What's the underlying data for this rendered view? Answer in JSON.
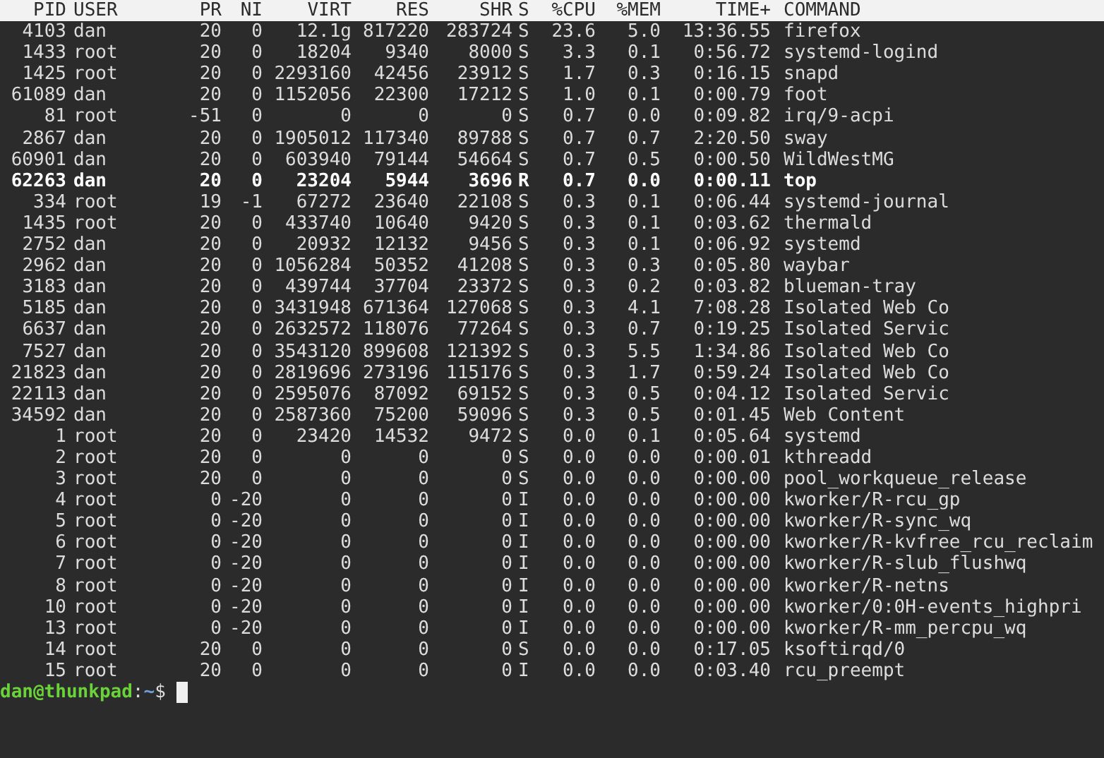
{
  "table": {
    "columns": [
      "PID",
      "USER",
      "PR",
      "NI",
      "VIRT",
      "RES",
      "SHR",
      "S",
      "%CPU",
      "%MEM",
      "TIME+",
      "COMMAND"
    ],
    "rows": [
      {
        "highlighted": false,
        "cells": [
          "4103",
          "dan",
          "20",
          "0",
          "12.1g",
          "817220",
          "283724",
          "S",
          "23.6",
          "5.0",
          "13:36.55",
          "firefox"
        ]
      },
      {
        "highlighted": false,
        "cells": [
          "1433",
          "root",
          "20",
          "0",
          "18204",
          "9340",
          "8000",
          "S",
          "3.3",
          "0.1",
          "0:56.72",
          "systemd-logind"
        ]
      },
      {
        "highlighted": false,
        "cells": [
          "1425",
          "root",
          "20",
          "0",
          "2293160",
          "42456",
          "23912",
          "S",
          "1.7",
          "0.3",
          "0:16.15",
          "snapd"
        ]
      },
      {
        "highlighted": false,
        "cells": [
          "61089",
          "dan",
          "20",
          "0",
          "1152056",
          "22300",
          "17212",
          "S",
          "1.0",
          "0.1",
          "0:00.79",
          "foot"
        ]
      },
      {
        "highlighted": false,
        "cells": [
          "81",
          "root",
          "-51",
          "0",
          "0",
          "0",
          "0",
          "S",
          "0.7",
          "0.0",
          "0:09.82",
          "irq/9-acpi"
        ]
      },
      {
        "highlighted": false,
        "cells": [
          "2867",
          "dan",
          "20",
          "0",
          "1905012",
          "117340",
          "89788",
          "S",
          "0.7",
          "0.7",
          "2:20.50",
          "sway"
        ]
      },
      {
        "highlighted": false,
        "cells": [
          "60901",
          "dan",
          "20",
          "0",
          "603940",
          "79144",
          "54664",
          "S",
          "0.7",
          "0.5",
          "0:00.50",
          "WildWestMG"
        ]
      },
      {
        "highlighted": true,
        "cells": [
          "62263",
          "dan",
          "20",
          "0",
          "23204",
          "5944",
          "3696",
          "R",
          "0.7",
          "0.0",
          "0:00.11",
          "top"
        ]
      },
      {
        "highlighted": false,
        "cells": [
          "334",
          "root",
          "19",
          "-1",
          "67272",
          "23640",
          "22108",
          "S",
          "0.3",
          "0.1",
          "0:06.44",
          "systemd-journal"
        ]
      },
      {
        "highlighted": false,
        "cells": [
          "1435",
          "root",
          "20",
          "0",
          "433740",
          "10640",
          "9420",
          "S",
          "0.3",
          "0.1",
          "0:03.62",
          "thermald"
        ]
      },
      {
        "highlighted": false,
        "cells": [
          "2752",
          "dan",
          "20",
          "0",
          "20932",
          "12132",
          "9456",
          "S",
          "0.3",
          "0.1",
          "0:06.92",
          "systemd"
        ]
      },
      {
        "highlighted": false,
        "cells": [
          "2962",
          "dan",
          "20",
          "0",
          "1056284",
          "50352",
          "41208",
          "S",
          "0.3",
          "0.3",
          "0:05.80",
          "waybar"
        ]
      },
      {
        "highlighted": false,
        "cells": [
          "3183",
          "dan",
          "20",
          "0",
          "439744",
          "37704",
          "23372",
          "S",
          "0.3",
          "0.2",
          "0:03.82",
          "blueman-tray"
        ]
      },
      {
        "highlighted": false,
        "cells": [
          "5185",
          "dan",
          "20",
          "0",
          "3431948",
          "671364",
          "127068",
          "S",
          "0.3",
          "4.1",
          "7:08.28",
          "Isolated Web Co"
        ]
      },
      {
        "highlighted": false,
        "cells": [
          "6637",
          "dan",
          "20",
          "0",
          "2632572",
          "118076",
          "77264",
          "S",
          "0.3",
          "0.7",
          "0:19.25",
          "Isolated Servic"
        ]
      },
      {
        "highlighted": false,
        "cells": [
          "7527",
          "dan",
          "20",
          "0",
          "3543120",
          "899608",
          "121392",
          "S",
          "0.3",
          "5.5",
          "1:34.86",
          "Isolated Web Co"
        ]
      },
      {
        "highlighted": false,
        "cells": [
          "21823",
          "dan",
          "20",
          "0",
          "2819696",
          "273196",
          "115176",
          "S",
          "0.3",
          "1.7",
          "0:59.24",
          "Isolated Web Co"
        ]
      },
      {
        "highlighted": false,
        "cells": [
          "22113",
          "dan",
          "20",
          "0",
          "2595076",
          "87092",
          "69152",
          "S",
          "0.3",
          "0.5",
          "0:04.12",
          "Isolated Servic"
        ]
      },
      {
        "highlighted": false,
        "cells": [
          "34592",
          "dan",
          "20",
          "0",
          "2587360",
          "75200",
          "59096",
          "S",
          "0.3",
          "0.5",
          "0:01.45",
          "Web Content"
        ]
      },
      {
        "highlighted": false,
        "cells": [
          "1",
          "root",
          "20",
          "0",
          "23420",
          "14532",
          "9472",
          "S",
          "0.0",
          "0.1",
          "0:05.64",
          "systemd"
        ]
      },
      {
        "highlighted": false,
        "cells": [
          "2",
          "root",
          "20",
          "0",
          "0",
          "0",
          "0",
          "S",
          "0.0",
          "0.0",
          "0:00.01",
          "kthreadd"
        ]
      },
      {
        "highlighted": false,
        "cells": [
          "3",
          "root",
          "20",
          "0",
          "0",
          "0",
          "0",
          "S",
          "0.0",
          "0.0",
          "0:00.00",
          "pool_workqueue_release"
        ]
      },
      {
        "highlighted": false,
        "cells": [
          "4",
          "root",
          "0",
          "-20",
          "0",
          "0",
          "0",
          "I",
          "0.0",
          "0.0",
          "0:00.00",
          "kworker/R-rcu_gp"
        ]
      },
      {
        "highlighted": false,
        "cells": [
          "5",
          "root",
          "0",
          "-20",
          "0",
          "0",
          "0",
          "I",
          "0.0",
          "0.0",
          "0:00.00",
          "kworker/R-sync_wq"
        ]
      },
      {
        "highlighted": false,
        "cells": [
          "6",
          "root",
          "0",
          "-20",
          "0",
          "0",
          "0",
          "I",
          "0.0",
          "0.0",
          "0:00.00",
          "kworker/R-kvfree_rcu_reclaim"
        ]
      },
      {
        "highlighted": false,
        "cells": [
          "7",
          "root",
          "0",
          "-20",
          "0",
          "0",
          "0",
          "I",
          "0.0",
          "0.0",
          "0:00.00",
          "kworker/R-slub_flushwq"
        ]
      },
      {
        "highlighted": false,
        "cells": [
          "8",
          "root",
          "0",
          "-20",
          "0",
          "0",
          "0",
          "I",
          "0.0",
          "0.0",
          "0:00.00",
          "kworker/R-netns"
        ]
      },
      {
        "highlighted": false,
        "cells": [
          "10",
          "root",
          "0",
          "-20",
          "0",
          "0",
          "0",
          "I",
          "0.0",
          "0.0",
          "0:00.00",
          "kworker/0:0H-events_highpri"
        ]
      },
      {
        "highlighted": false,
        "cells": [
          "13",
          "root",
          "0",
          "-20",
          "0",
          "0",
          "0",
          "I",
          "0.0",
          "0.0",
          "0:00.00",
          "kworker/R-mm_percpu_wq"
        ]
      },
      {
        "highlighted": false,
        "cells": [
          "14",
          "root",
          "20",
          "0",
          "0",
          "0",
          "0",
          "S",
          "0.0",
          "0.0",
          "0:17.05",
          "ksoftirqd/0"
        ]
      },
      {
        "highlighted": false,
        "cells": [
          "15",
          "root",
          "20",
          "0",
          "0",
          "0",
          "0",
          "I",
          "0.0",
          "0.0",
          "0:03.40",
          "rcu_preempt"
        ]
      }
    ]
  },
  "prompt": {
    "user_host": "dan@thunkpad",
    "separator": ":",
    "path": "~",
    "symbol": "$"
  }
}
